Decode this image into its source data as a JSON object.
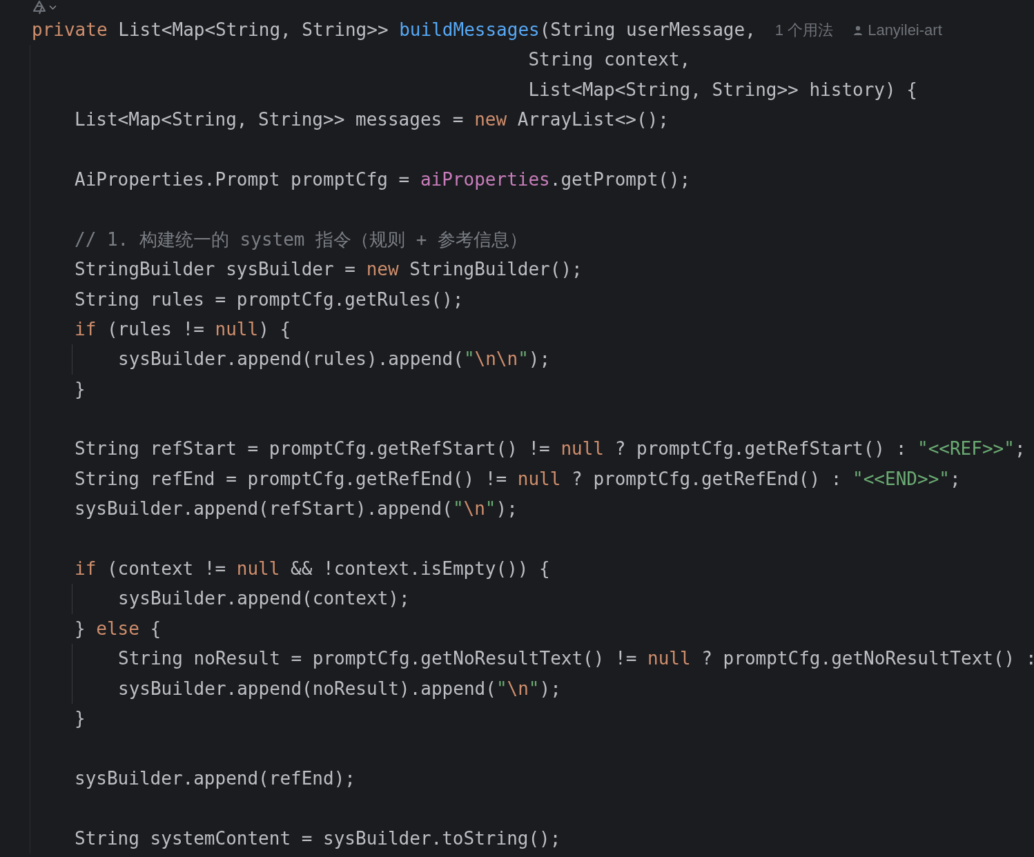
{
  "lines": [
    {
      "kind": "code",
      "tokens": [
        {
          "kind": "keyword",
          "text": "private"
        },
        {
          "kind": "plain",
          "text": " List<Map<String, String>> "
        },
        {
          "kind": "method",
          "text": "buildMessages"
        },
        {
          "kind": "plain",
          "text": "(String userMessage,"
        }
      ],
      "hints": {
        "usages": "1 个用法",
        "author": "Lanyilei-art"
      },
      "children": [
        {
          "kind": "continuation",
          "tokens": [
            {
              "kind": "plain",
              "text": "String context,"
            }
          ]
        },
        {
          "kind": "continuation",
          "tokens": [
            {
              "kind": "plain",
              "text": "List<Map<String, String>> history) {"
            }
          ]
        },
        {
          "kind": "code",
          "tokens": [
            {
              "kind": "plain",
              "text": "List<Map<String, String>> messages = "
            },
            {
              "kind": "keyword",
              "text": "new"
            },
            {
              "kind": "plain",
              "text": " ArrayList<>();"
            }
          ]
        },
        {
          "kind": "blank"
        },
        {
          "kind": "code",
          "tokens": [
            {
              "kind": "plain",
              "text": "AiProperties.Prompt promptCfg = "
            },
            {
              "kind": "field",
              "text": "aiProperties"
            },
            {
              "kind": "plain",
              "text": ".getPrompt();"
            }
          ]
        },
        {
          "kind": "blank"
        },
        {
          "kind": "code",
          "tokens": [
            {
              "kind": "comment",
              "text": "// 1. 构建统一的 system 指令（规则 + 参考信息）"
            }
          ]
        },
        {
          "kind": "code",
          "tokens": [
            {
              "kind": "plain",
              "text": "StringBuilder sysBuilder = "
            },
            {
              "kind": "keyword",
              "text": "new"
            },
            {
              "kind": "plain",
              "text": " StringBuilder();"
            }
          ]
        },
        {
          "kind": "code",
          "tokens": [
            {
              "kind": "plain",
              "text": "String rules = promptCfg.getRules();"
            }
          ]
        },
        {
          "kind": "code",
          "tokens": [
            {
              "kind": "keyword",
              "text": "if"
            },
            {
              "kind": "plain",
              "text": " (rules != "
            },
            {
              "kind": "keyword",
              "text": "null"
            },
            {
              "kind": "plain",
              "text": ") {"
            }
          ],
          "children": [
            {
              "kind": "code",
              "tokens": [
                {
                  "kind": "plain",
                  "text": "sysBuilder.append(rules).append("
                },
                {
                  "kind": "string",
                  "text": "\""
                },
                {
                  "kind": "escape",
                  "text": "\\n\\n"
                },
                {
                  "kind": "string",
                  "text": "\""
                },
                {
                  "kind": "plain",
                  "text": ");"
                }
              ]
            }
          ]
        },
        {
          "kind": "code",
          "tokens": [
            {
              "kind": "plain",
              "text": "}"
            }
          ]
        },
        {
          "kind": "blank"
        },
        {
          "kind": "code",
          "tokens": [
            {
              "kind": "plain",
              "text": "String refStart = promptCfg.getRefStart() != "
            },
            {
              "kind": "keyword",
              "text": "null"
            },
            {
              "kind": "plain",
              "text": " ? promptCfg.getRefStart() : "
            },
            {
              "kind": "string",
              "text": "\"<<REF>>\""
            },
            {
              "kind": "plain",
              "text": ";"
            }
          ]
        },
        {
          "kind": "code",
          "tokens": [
            {
              "kind": "plain",
              "text": "String refEnd = promptCfg.getRefEnd() != "
            },
            {
              "kind": "keyword",
              "text": "null"
            },
            {
              "kind": "plain",
              "text": " ? promptCfg.getRefEnd() : "
            },
            {
              "kind": "string",
              "text": "\"<<END>>\""
            },
            {
              "kind": "plain",
              "text": ";"
            }
          ]
        },
        {
          "kind": "code",
          "tokens": [
            {
              "kind": "plain",
              "text": "sysBuilder.append(refStart).append("
            },
            {
              "kind": "string",
              "text": "\""
            },
            {
              "kind": "escape",
              "text": "\\n"
            },
            {
              "kind": "string",
              "text": "\""
            },
            {
              "kind": "plain",
              "text": ");"
            }
          ]
        },
        {
          "kind": "blank"
        },
        {
          "kind": "code",
          "tokens": [
            {
              "kind": "keyword",
              "text": "if"
            },
            {
              "kind": "plain",
              "text": " (context != "
            },
            {
              "kind": "keyword",
              "text": "null"
            },
            {
              "kind": "plain",
              "text": " && !context.isEmpty()) {"
            }
          ],
          "children": [
            {
              "kind": "code",
              "tokens": [
                {
                  "kind": "plain",
                  "text": "sysBuilder.append(context);"
                }
              ]
            }
          ]
        },
        {
          "kind": "code",
          "tokens": [
            {
              "kind": "plain",
              "text": "} "
            },
            {
              "kind": "keyword",
              "text": "else"
            },
            {
              "kind": "plain",
              "text": " {"
            }
          ],
          "children": [
            {
              "kind": "code",
              "tokens": [
                {
                  "kind": "plain",
                  "text": "String noResult = promptCfg.getNoResultText() != "
                },
                {
                  "kind": "keyword",
                  "text": "null"
                },
                {
                  "kind": "plain",
                  "text": " ? promptCfg.getNoResultText() :"
                }
              ]
            },
            {
              "kind": "code",
              "tokens": [
                {
                  "kind": "plain",
                  "text": "sysBuilder.append(noResult).append("
                },
                {
                  "kind": "string",
                  "text": "\""
                },
                {
                  "kind": "escape",
                  "text": "\\n"
                },
                {
                  "kind": "string",
                  "text": "\""
                },
                {
                  "kind": "plain",
                  "text": ");"
                }
              ]
            }
          ]
        },
        {
          "kind": "code",
          "tokens": [
            {
              "kind": "plain",
              "text": "}"
            }
          ]
        },
        {
          "kind": "blank"
        },
        {
          "kind": "code",
          "tokens": [
            {
              "kind": "plain",
              "text": "sysBuilder.append(refEnd);"
            }
          ]
        },
        {
          "kind": "blank"
        },
        {
          "kind": "code",
          "tokens": [
            {
              "kind": "plain",
              "text": "String systemContent = sysBuilder.toString();"
            }
          ]
        }
      ]
    }
  ]
}
